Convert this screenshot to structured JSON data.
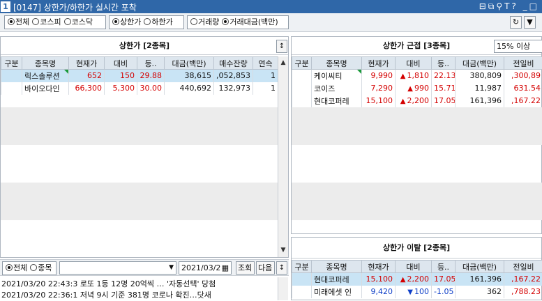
{
  "window": {
    "number": "1",
    "title": "[0147] 상한가/하한가 실시간 포착",
    "icons": "⊟⧉⚲T?  _□"
  },
  "filters": {
    "market": [
      "전체",
      "코스피",
      "코스닥"
    ],
    "market_selected": 0,
    "limit": [
      "상한가",
      "하한가"
    ],
    "limit_selected": 0,
    "sort": [
      "거래량",
      "거래대금(백만)"
    ],
    "sort_selected": 1,
    "refresh": "↻",
    "menu": "▼"
  },
  "upper_panel": {
    "title": "상한가 [2종목]",
    "columns": [
      "구분",
      "종목명",
      "현재가",
      "대비",
      "등..",
      "대금(백만)",
      "매수잔량",
      "연속"
    ],
    "rows": [
      {
        "name": "릭스솔루션",
        "price": "652",
        "change": "150",
        "rate": "29.88",
        "amount": "38,615",
        "bid": ",052,853",
        "streak": "1"
      },
      {
        "name": "바이오다인",
        "price": "66,300",
        "change": "5,300",
        "rate": "30.00",
        "amount": "440,692",
        "bid": "132,973",
        "streak": "1"
      }
    ]
  },
  "near_panel": {
    "title": "상한가 근접 [3종목]",
    "threshold": "15% 이상",
    "columns": [
      "구분",
      "종목명",
      "현재가",
      "대비",
      "등..",
      "대금(백만)",
      "전일비"
    ],
    "rows": [
      {
        "name": "케이씨티",
        "price": "9,990",
        "arrow": "▲",
        "change": "1,810",
        "rate": "22.13",
        "amount": "380,809",
        "prev": ",300,89"
      },
      {
        "name": "코이즈",
        "price": "7,290",
        "arrow": "▲",
        "change": "990",
        "rate": "15.71",
        "amount": "11,987",
        "prev": "631.54"
      },
      {
        "name": "현대코퍼레",
        "price": "15,100",
        "arrow": "▲",
        "change": "2,200",
        "rate": "17.05",
        "amount": "161,396",
        "prev": ",167.22"
      }
    ]
  },
  "escape_panel": {
    "title": "상한가 이탈 [2종목]",
    "columns": [
      "구분",
      "종목명",
      "현재가",
      "대비",
      "등..",
      "대금(백만)",
      "전일비"
    ],
    "rows": [
      {
        "name": "현대코퍼레",
        "price": "15,100",
        "arrow": "▲",
        "change": "2,200",
        "rate": "17.05",
        "amount": "161,396",
        "prev": ",167.22"
      },
      {
        "name": "미래에셋 인",
        "price": "9,420",
        "arrow": "▼",
        "change": "100",
        "rate": "-1.05",
        "amount": "362",
        "prev": ",788.23"
      }
    ]
  },
  "news": {
    "scope": [
      "전체",
      "종목"
    ],
    "scope_selected": 0,
    "date": "2021/03/2",
    "query_button": "조회",
    "next_button": "다음",
    "items": [
      {
        "date": "2021/03/20",
        "time": "22:43:3",
        "text": "로또 1등 12명 20억씩 … '자동선택' 당첨"
      },
      {
        "date": "2021/03/20",
        "time": "22:36:1",
        "text": "저녁 9시 기준 381명 코로나 확진…닷새"
      }
    ]
  }
}
